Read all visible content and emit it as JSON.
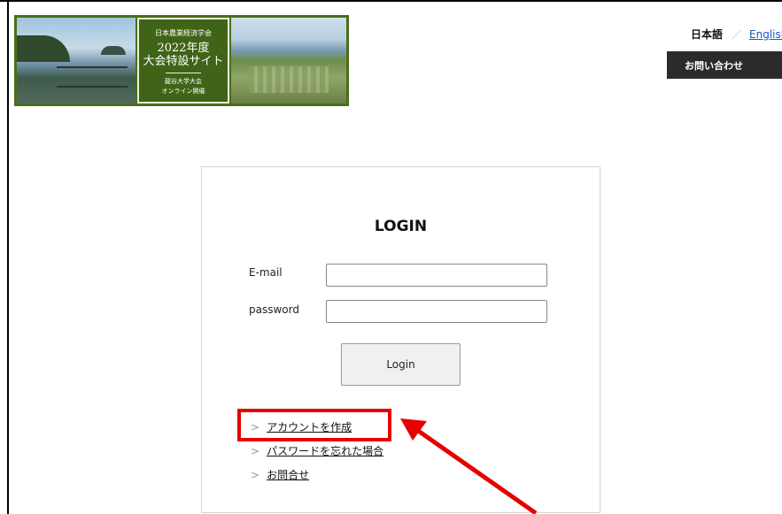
{
  "banner": {
    "line1": "日本農業経済学会",
    "line2": "2022年度",
    "line3": "大会特設サイト",
    "line4": "龍谷大学大会",
    "line5": "オンライン開催"
  },
  "header": {
    "lang_ja": "日本語",
    "lang_sep": "／",
    "lang_en": "English",
    "contact_label": "お問い合わせ"
  },
  "login": {
    "title": "LOGIN",
    "email_label": "E-mail",
    "email_value": "",
    "password_label": "password",
    "password_value": "",
    "submit_label": "Login"
  },
  "links": [
    {
      "chevron": ">",
      "label": "アカウントを作成"
    },
    {
      "chevron": ">",
      "label": "パスワードを忘れた場合"
    },
    {
      "chevron": ">",
      "label": "お問合せ"
    }
  ],
  "annotation": {
    "color": "#e60000"
  }
}
